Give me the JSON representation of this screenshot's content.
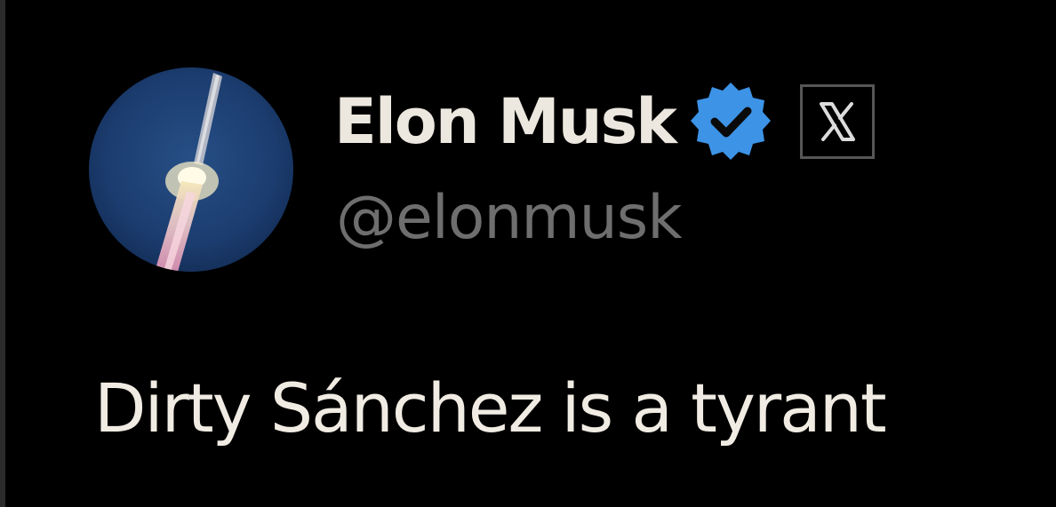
{
  "tweet": {
    "author": {
      "display_name": "Elon Musk",
      "handle": "@elonmusk",
      "verified_icon": "verified-badge-icon",
      "platform_icon": "x-logo-icon",
      "avatar_icon": "rocket-launch-avatar"
    },
    "text": "Dirty Sánchez is a tyrant"
  },
  "colors": {
    "background": "#000000",
    "name_text": "#ece7df",
    "handle_text": "#6e6e6e",
    "verified_badge": "#3d93e6",
    "x_box_border": "#565656"
  }
}
